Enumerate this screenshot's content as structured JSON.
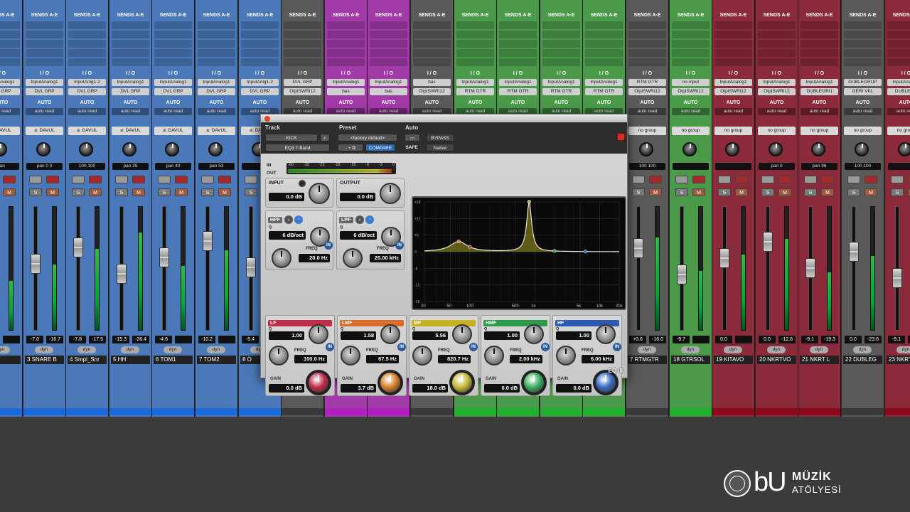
{
  "mixer": {
    "sends_label": "SENDS A-E",
    "io_label": "I / O",
    "strips": [
      {
        "color": "#4a78b8",
        "bar": "#1a6ad8",
        "input": "InputAnalog1",
        "output": "DVL GRP",
        "auto": "AUTO",
        "mode": "auto read",
        "group": "a: DAVUL",
        "pan": "pan",
        "pan_l": "",
        "pan_r": "",
        "vol": "-7.1",
        "vol2": "",
        "name": "ARE T"
      },
      {
        "color": "#4a78b8",
        "bar": "#1a6ad8",
        "input": "InputAnalog1",
        "output": "DVL GRP",
        "auto": "AUTO",
        "mode": "auto read",
        "group": "a: DAVUL",
        "pan": "pan",
        "pan_l": "0",
        "pan_r": "0",
        "vol": "-7.0",
        "vol2": "-16.7",
        "name": "3 SNARE B"
      },
      {
        "color": "#4a78b8",
        "bar": "#1a6ad8",
        "input": "InputAnlg1-2",
        "output": "DVL GRP",
        "auto": "AUTO",
        "mode": "auto read",
        "group": "a: DAVUL",
        "pan": "",
        "pan_l": "100",
        "pan_r": "100",
        "vol": "-7.8",
        "vol2": "-17.5",
        "name": "4 Smpl_Snr"
      },
      {
        "color": "#4a78b8",
        "bar": "#1a6ad8",
        "input": "InputAnalog1",
        "output": "DVL GRP",
        "auto": "AUTO",
        "mode": "auto read",
        "group": "a: DAVUL",
        "pan": "pan",
        "pan_l": "",
        "pan_r": "25",
        "vol": "-15.3",
        "vol2": "-26.4",
        "name": "5 HH"
      },
      {
        "color": "#4a78b8",
        "bar": "#1a6ad8",
        "input": "InputAnalog1",
        "output": "DVL GRP",
        "auto": "AUTO",
        "mode": "auto read",
        "group": "a: DAVUL",
        "pan": "pan",
        "pan_l": "",
        "pan_r": "40",
        "vol": "-4.6",
        "vol2": "",
        "name": "6 TOM1"
      },
      {
        "color": "#4a78b8",
        "bar": "#1a6ad8",
        "input": "InputAnalog1",
        "output": "DVL GRP",
        "auto": "AUTO",
        "mode": "auto read",
        "group": "a: DAVUL",
        "pan": "pan",
        "pan_l": "",
        "pan_r": "53",
        "vol": "-10.2",
        "vol2": "",
        "name": "7 TOM2"
      },
      {
        "color": "#4a78b8",
        "bar": "#1a6ad8",
        "input": "InputAnlg1-2",
        "output": "DVL GRP",
        "auto": "AUTO",
        "mode": "auto read",
        "group": "a: DAVUL",
        "pan": "",
        "pan_l": "",
        "pan_r": "",
        "vol": "-5.4",
        "vol2": "",
        "name": "8 O"
      },
      {
        "color": "#5a5a5a",
        "bar": "#3a3a3a",
        "input": "DVL GRP",
        "output": "OtptSWRt12",
        "auto": "AUTO",
        "mode": "auto read",
        "group": "",
        "pan": "",
        "pan_l": "",
        "pan_r": "",
        "vol": "",
        "vol2": "",
        "name": ""
      },
      {
        "color": "#a23aa8",
        "bar": "#b020c0",
        "input": "InputAnalog1",
        "output": "bas",
        "auto": "AUTO",
        "mode": "auto read",
        "group": "",
        "pan": "",
        "pan_l": "",
        "pan_r": "",
        "vol": "",
        "vol2": "",
        "name": ""
      },
      {
        "color": "#a23aa8",
        "bar": "#b020c0",
        "input": "InputAnalog1",
        "output": "bas",
        "auto": "AUTO",
        "mode": "auto read",
        "group": "",
        "pan": "",
        "pan_l": "",
        "pan_r": "",
        "vol": "",
        "vol2": "",
        "name": ""
      },
      {
        "color": "#5a5a5a",
        "bar": "#3a3a3a",
        "input": "bas",
        "output": "OtptSWRt12",
        "auto": "AUTO",
        "mode": "auto read",
        "group": "",
        "pan": "",
        "pan_l": "",
        "pan_r": "",
        "vol": "",
        "vol2": "",
        "name": ""
      },
      {
        "color": "#4a9a4a",
        "bar": "#20b030",
        "input": "InputAnalog1",
        "output": "RTM GTR",
        "auto": "AUTO",
        "mode": "auto read",
        "group": "",
        "pan": "",
        "pan_l": "",
        "pan_r": "",
        "vol": "",
        "vol2": "",
        "name": ""
      },
      {
        "color": "#4a9a4a",
        "bar": "#20b030",
        "input": "InputAnalog1",
        "output": "RTM GTR",
        "auto": "AUTO",
        "mode": "auto read",
        "group": "",
        "pan": "",
        "pan_l": "",
        "pan_r": "",
        "vol": "",
        "vol2": "",
        "name": ""
      },
      {
        "color": "#4a9a4a",
        "bar": "#20b030",
        "input": "InputAnalog1",
        "output": "RTM GTR",
        "auto": "AUTO",
        "mode": "auto read",
        "group": "",
        "pan": "",
        "pan_l": "",
        "pan_r": "",
        "vol": "",
        "vol2": "",
        "name": ""
      },
      {
        "color": "#4a9a4a",
        "bar": "#20b030",
        "input": "InputAnalog1",
        "output": "RTM GTR",
        "auto": "AUTO",
        "mode": "auto read",
        "group": "",
        "pan": "",
        "pan_l": "",
        "pan_r": "",
        "vol": "",
        "vol2": "",
        "name": ""
      },
      {
        "color": "#5a5a5a",
        "bar": "#3a3a3a",
        "input": "RTM GTR",
        "output": "OtptSWRt12",
        "auto": "AUTO",
        "mode": "auto read",
        "group": "no group",
        "pan": "",
        "pan_l": "100",
        "pan_r": "100",
        "vol": "+0.6",
        "vol2": "-16.0",
        "name": "7 RTMGTR"
      },
      {
        "color": "#4a9a4a",
        "bar": "#20b030",
        "input": "no input",
        "output": "OtptSWRt12",
        "auto": "AUTO",
        "mode": "auto read",
        "group": "no group",
        "pan": "",
        "pan_l": "",
        "pan_r": "",
        "vol": "-9.7",
        "vol2": "",
        "name": "18 GTRSOL"
      },
      {
        "color": "#8a2a3a",
        "bar": "#8a0a1a",
        "input": "InputAnalog1",
        "output": "OtptSWRt12",
        "auto": "AUTO",
        "mode": "auto read",
        "group": "no group",
        "pan": "",
        "pan_l": "",
        "pan_r": "",
        "vol": "0.0",
        "vol2": "",
        "name": "19 KITAVO"
      },
      {
        "color": "#8a2a3a",
        "bar": "#8a0a1a",
        "input": "InputAnalog1",
        "output": "OtptSWRt12",
        "auto": "AUTO",
        "mode": "auto read",
        "group": "no group",
        "pan": "pan",
        "pan_l": "",
        "pan_r": "0",
        "vol": "0.0",
        "vol2": "-12.6",
        "name": "20 NKRTVO"
      },
      {
        "color": "#8a2a3a",
        "bar": "#8a0a1a",
        "input": "InputAnalog1",
        "output": "DUBLEGRU",
        "auto": "AUTO",
        "mode": "auto read",
        "group": "no group",
        "pan": "pan",
        "pan_l": "",
        "pan_r": "96",
        "vol": "-9.1",
        "vol2": "-19.3",
        "name": "21 NKRT L"
      },
      {
        "color": "#5a5a5a",
        "bar": "#3a3a3a",
        "input": "DUBLEGRUP",
        "output": "GERI VKL",
        "auto": "AUTO",
        "mode": "auto read",
        "group": "no group",
        "pan": "",
        "pan_l": "100",
        "pan_r": "100",
        "vol": "0.0",
        "vol2": "-23.6",
        "name": "22 DUBLEG"
      },
      {
        "color": "#8a2a3a",
        "bar": "#8a0a1a",
        "input": "InputAnalog1",
        "output": "DUBLEGR",
        "auto": "AUTO",
        "mode": "auto read",
        "group": "no group",
        "pan": "",
        "pan_l": "",
        "pan_r": "",
        "vol": "-9.1",
        "vol2": "",
        "name": "23 NKRTL"
      }
    ]
  },
  "plugin": {
    "track_label": "Track",
    "track_name": "KICK",
    "track_c": "c",
    "insert": "EQ3 7-Band",
    "preset_label": "Preset",
    "preset_value": "<factory default>",
    "preset_ctrl": "- + ⧉",
    "compare": "COMPARE",
    "auto_label": "Auto",
    "safe": "SAFE",
    "bypass": "BYPASS",
    "native": "Native",
    "meter_in": "IN",
    "meter_out": "OUT",
    "meter_scale": [
      "-60",
      "-32",
      "-22",
      "-16",
      "-10",
      "-6",
      "-3",
      "0"
    ],
    "input_label": "INPUT",
    "input_value": "0.0 dB",
    "output_label": "OUTPUT",
    "output_value": "0.0 dB",
    "hpf_label": "HPF",
    "hpf_q": "6 dB/oct",
    "hpf_freq_label": "FREQ",
    "hpf_freq": "20.0 Hz",
    "lpf_label": "LPF",
    "lpf_q": "6 dB/oct",
    "lpf_freq_label": "FREQ",
    "lpf_freq": "20.00 kHz",
    "q_label": "Q",
    "in_label": "IN",
    "bands": [
      {
        "tag": "LF",
        "color": "#c02c4a",
        "q": "1.00",
        "freq": "100.0 Hz",
        "gain": "0.0 dB",
        "knob": "#c02c4a"
      },
      {
        "tag": "LMF",
        "color": "#d86a2a",
        "q": "1.58",
        "freq": "67.5 Hz",
        "gain": "3.7 dB",
        "knob": "#d8802a"
      },
      {
        "tag": "MF",
        "color": "#c8b020",
        "q": "5.56",
        "freq": "820.7 Hz",
        "gain": "18.0 dB",
        "knob": "#c8b83a"
      },
      {
        "tag": "HMF",
        "color": "#2c9a4a",
        "q": "1.00",
        "freq": "2.00 kHz",
        "gain": "0.0 dB",
        "knob": "#3ab060"
      },
      {
        "tag": "HF",
        "color": "#2c5ab0",
        "q": "1.00",
        "freq": "6.00 kHz",
        "gain": "0.0 dB",
        "knob": "#3a6ac0"
      }
    ],
    "graph_y": [
      "+18",
      "+12",
      "+6",
      "0",
      "-6",
      "-12",
      "-18"
    ],
    "graph_x": [
      "20",
      "50",
      "100",
      "500",
      "1k",
      "5k",
      "10k",
      "20k"
    ],
    "badge": "EQ III"
  },
  "logo": {
    "b": "bU",
    "line1": "MÜZİK",
    "line2": "ATÖLYESİ"
  }
}
